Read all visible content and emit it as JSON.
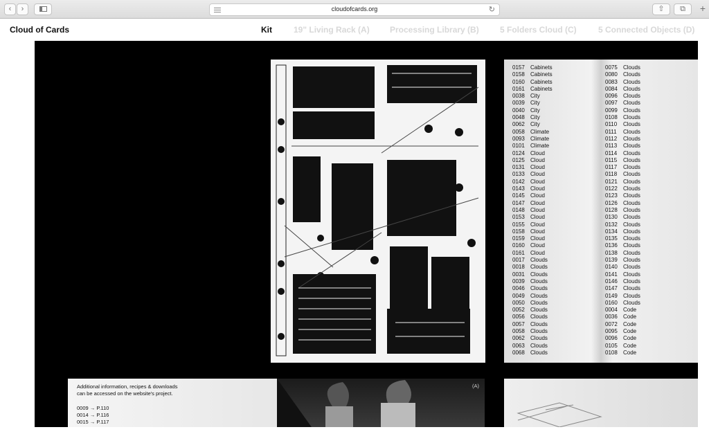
{
  "browser": {
    "url": "cloudofcards.org",
    "back_icon": "‹",
    "forward_icon": "›",
    "reload_icon": "↻",
    "share_icon": "⇧",
    "tabs_icon": "⧉",
    "new_tab_icon": "+"
  },
  "site": {
    "title": "Cloud of Cards",
    "nav": [
      "Kit",
      "19\" Living Rack (A)",
      "Processing Library (B)",
      "5 Folders Cloud (C)",
      "5 Connected Objects (D)"
    ],
    "active_nav": "Kit"
  },
  "index_left": [
    [
      "0157",
      "Cabinets"
    ],
    [
      "0158",
      "Cabinets"
    ],
    [
      "0160",
      "Cabinets"
    ],
    [
      "0161",
      "Cabinets"
    ],
    [
      "0038",
      "City"
    ],
    [
      "0039",
      "City"
    ],
    [
      "0040",
      "City"
    ],
    [
      "0048",
      "City"
    ],
    [
      "0062",
      "City"
    ],
    [
      "0058",
      "Climate"
    ],
    [
      "0093",
      "Climate"
    ],
    [
      "0101",
      "Climate"
    ],
    [
      "0124",
      "Cloud"
    ],
    [
      "0125",
      "Cloud"
    ],
    [
      "0131",
      "Cloud"
    ],
    [
      "0133",
      "Cloud"
    ],
    [
      "0142",
      "Cloud"
    ],
    [
      "0143",
      "Cloud"
    ],
    [
      "0145",
      "Cloud"
    ],
    [
      "0147",
      "Cloud"
    ],
    [
      "0148",
      "Cloud"
    ],
    [
      "0153",
      "Cloud"
    ],
    [
      "0155",
      "Cloud"
    ],
    [
      "0158",
      "Cloud"
    ],
    [
      "0159",
      "Cloud"
    ],
    [
      "0160",
      "Cloud"
    ],
    [
      "0161",
      "Cloud"
    ],
    [
      "0017",
      "Clouds"
    ],
    [
      "0018",
      "Clouds"
    ],
    [
      "0031",
      "Clouds"
    ],
    [
      "0039",
      "Clouds"
    ],
    [
      "0046",
      "Clouds"
    ],
    [
      "0049",
      "Clouds"
    ],
    [
      "0050",
      "Clouds"
    ],
    [
      "0052",
      "Clouds"
    ],
    [
      "0056",
      "Clouds"
    ],
    [
      "0057",
      "Clouds"
    ],
    [
      "0058",
      "Clouds"
    ],
    [
      "0062",
      "Clouds"
    ],
    [
      "0063",
      "Clouds"
    ],
    [
      "0068",
      "Clouds"
    ]
  ],
  "index_right": [
    [
      "0075",
      "Clouds"
    ],
    [
      "0080",
      "Clouds"
    ],
    [
      "0083",
      "Clouds"
    ],
    [
      "0084",
      "Clouds"
    ],
    [
      "0096",
      "Clouds"
    ],
    [
      "0097",
      "Clouds"
    ],
    [
      "0099",
      "Clouds"
    ],
    [
      "0108",
      "Clouds"
    ],
    [
      "0110",
      "Clouds"
    ],
    [
      "0111",
      "Clouds"
    ],
    [
      "0112",
      "Clouds"
    ],
    [
      "0113",
      "Clouds"
    ],
    [
      "0114",
      "Clouds"
    ],
    [
      "0115",
      "Clouds"
    ],
    [
      "0117",
      "Clouds"
    ],
    [
      "0118",
      "Clouds"
    ],
    [
      "0121",
      "Clouds"
    ],
    [
      "0122",
      "Clouds"
    ],
    [
      "0123",
      "Clouds"
    ],
    [
      "0126",
      "Clouds"
    ],
    [
      "0128",
      "Clouds"
    ],
    [
      "0130",
      "Clouds"
    ],
    [
      "0132",
      "Clouds"
    ],
    [
      "0134",
      "Clouds"
    ],
    [
      "0135",
      "Clouds"
    ],
    [
      "0136",
      "Clouds"
    ],
    [
      "0138",
      "Clouds"
    ],
    [
      "0139",
      "Clouds"
    ],
    [
      "0140",
      "Clouds"
    ],
    [
      "0141",
      "Clouds"
    ],
    [
      "0146",
      "Clouds"
    ],
    [
      "0147",
      "Clouds"
    ],
    [
      "0149",
      "Clouds"
    ],
    [
      "0160",
      "Clouds"
    ],
    [
      "0004",
      "Code"
    ],
    [
      "0036",
      "Code"
    ],
    [
      "0072",
      "Code"
    ],
    [
      "0095",
      "Code"
    ],
    [
      "0096",
      "Code"
    ],
    [
      "0105",
      "Code"
    ],
    [
      "0108",
      "Code"
    ]
  ],
  "bottom_left": {
    "text_line1": "Additional information, recipes & downloads",
    "text_line2": "can be accessed on the website's project.",
    "refs": [
      "0009 → P.110",
      "0014 → P.116",
      "0015 → P.117"
    ]
  },
  "bottom_mid": {
    "label": "(A)"
  }
}
